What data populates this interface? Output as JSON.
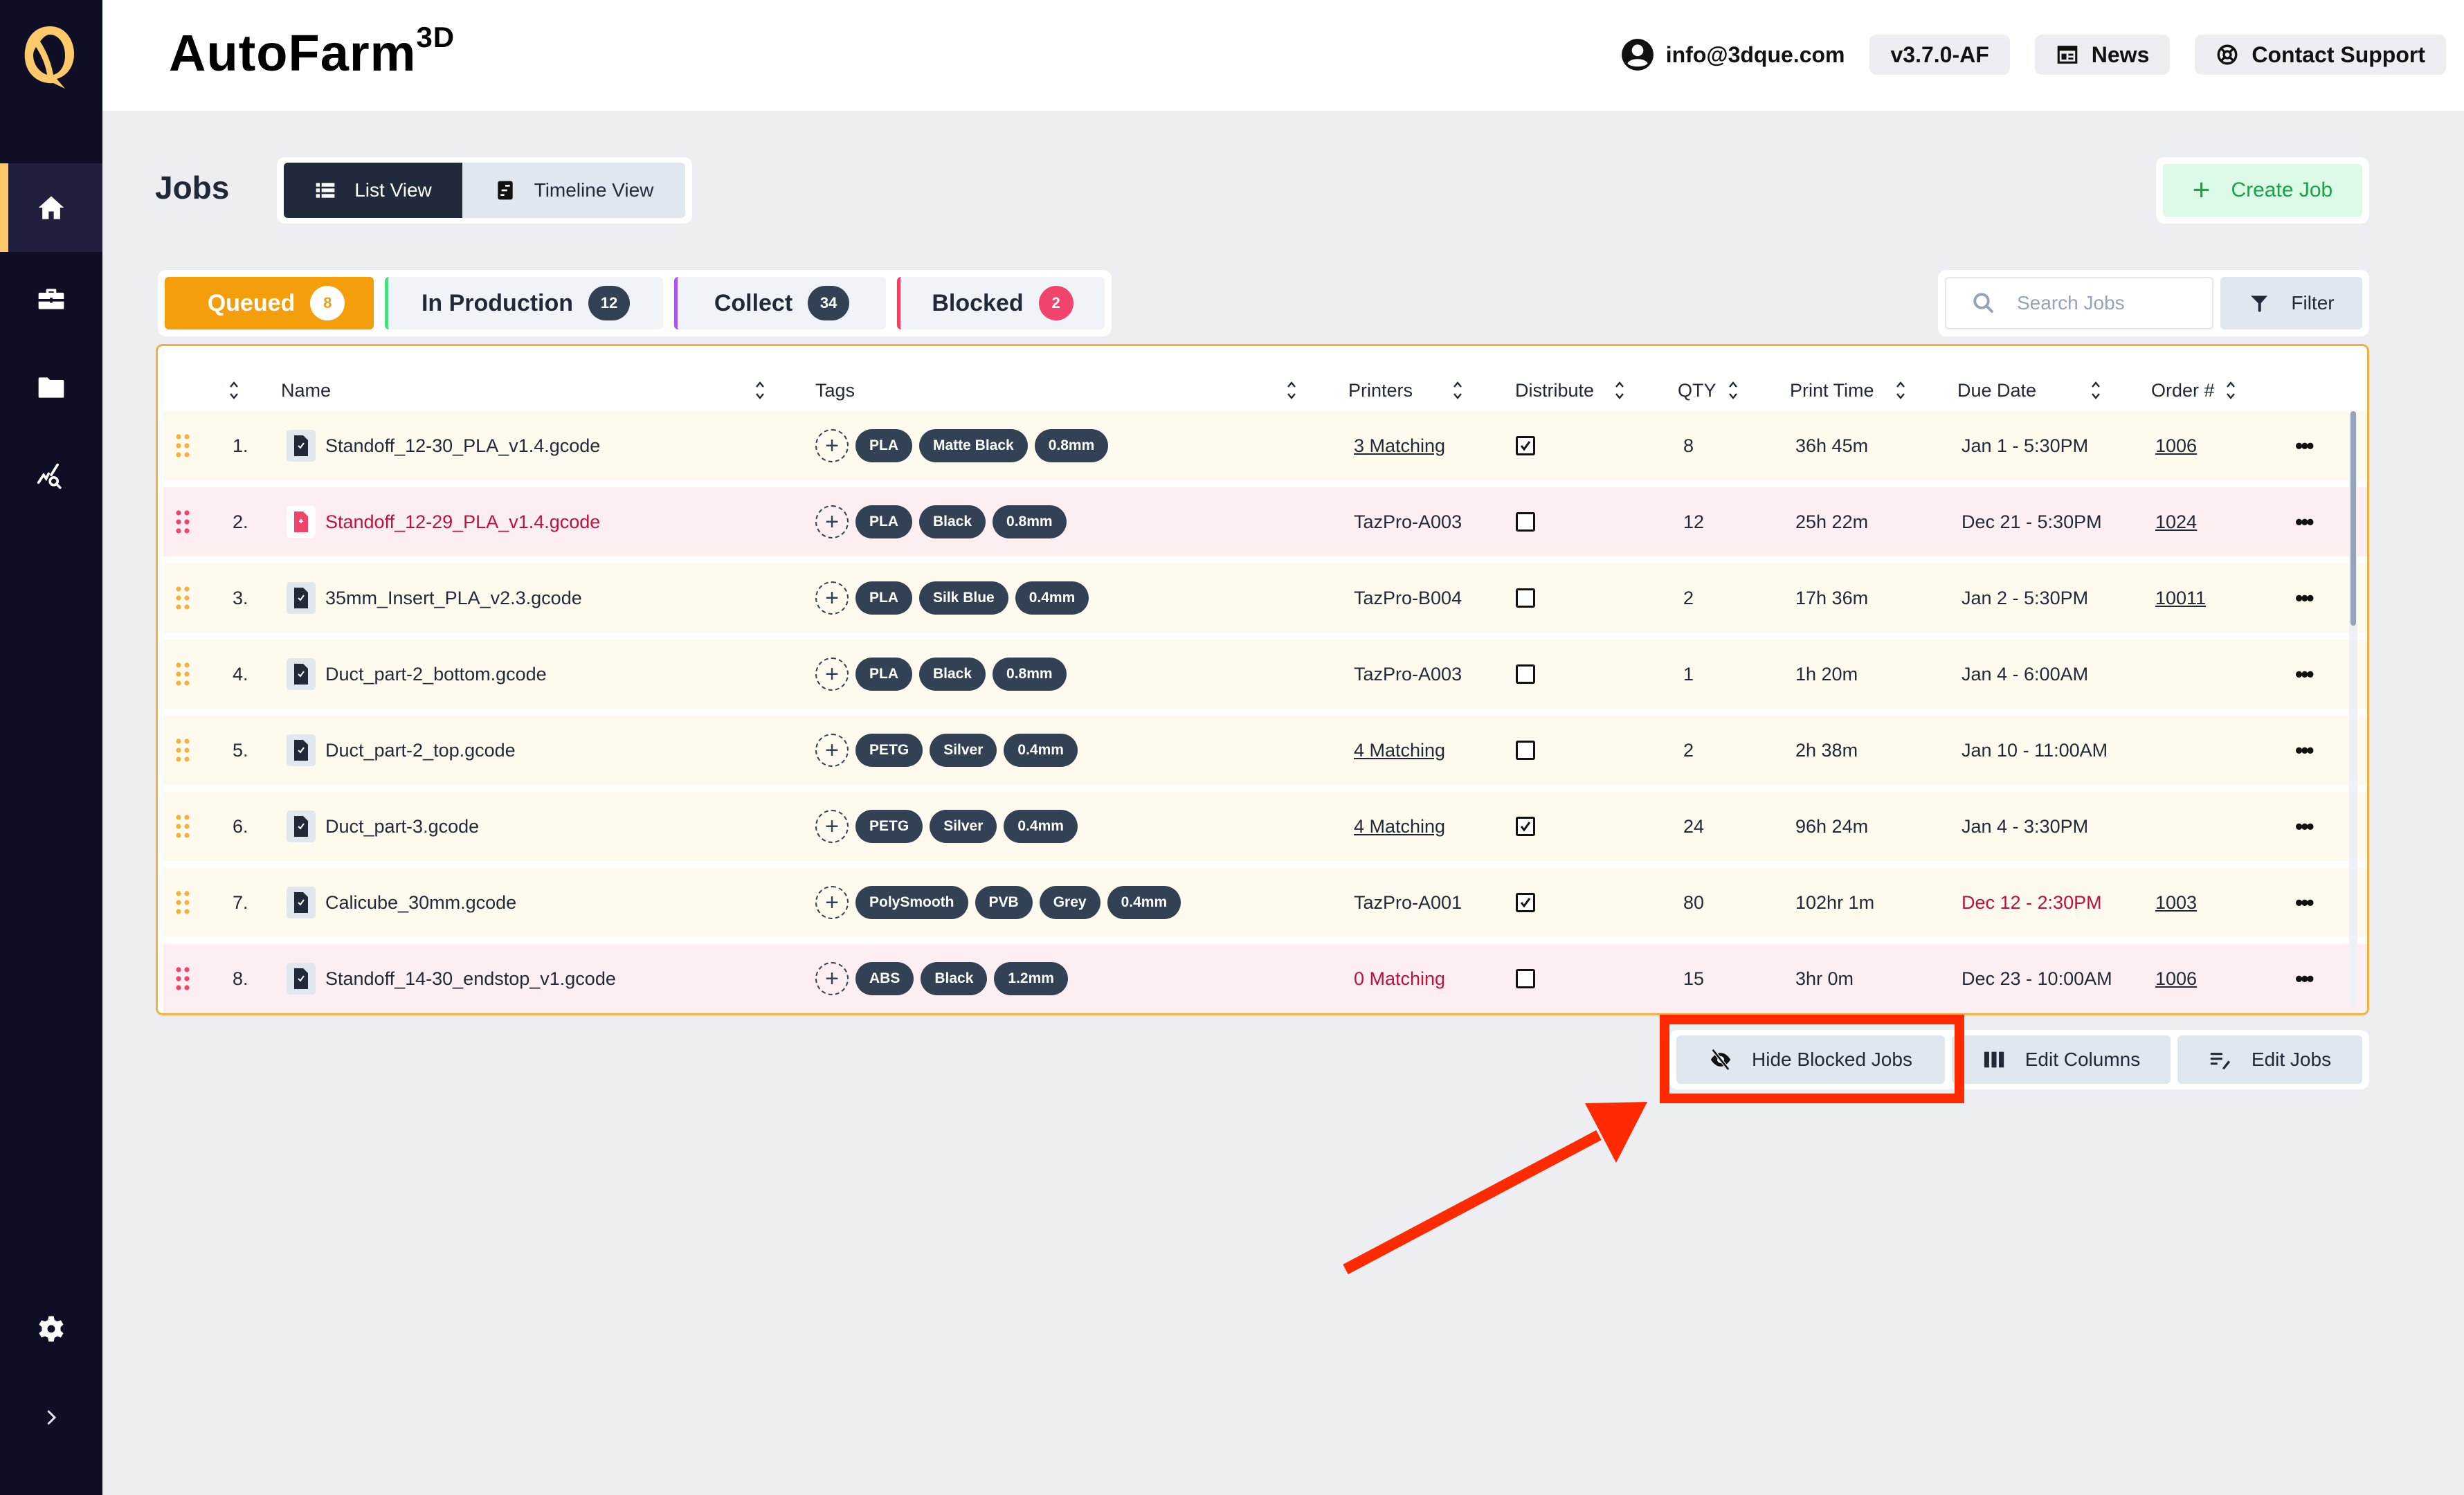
{
  "app": {
    "title": "AutoFarm",
    "title_sup": "3D",
    "user_email": "info@3dque.com",
    "version": "v3.7.0-AF",
    "news_label": "News",
    "support_label": "Contact Support"
  },
  "sidebar": {
    "items": [
      {
        "icon": "home-icon",
        "active": true
      },
      {
        "icon": "briefcase-icon",
        "active": false
      },
      {
        "icon": "folder-icon",
        "active": false
      },
      {
        "icon": "analytics-icon",
        "active": false
      }
    ],
    "bottom": [
      {
        "icon": "gear-icon"
      },
      {
        "icon": "chevron-right-icon"
      }
    ]
  },
  "page": {
    "title": "Jobs",
    "views": [
      {
        "label": "List View",
        "active": true
      },
      {
        "label": "Timeline View",
        "active": false
      }
    ],
    "create_label": "Create Job"
  },
  "tabs": [
    {
      "label": "Queued",
      "count": "8",
      "active": true
    },
    {
      "label": "In Production",
      "count": "12"
    },
    {
      "label": "Collect",
      "count": "34"
    },
    {
      "label": "Blocked",
      "count": "2"
    }
  ],
  "search": {
    "placeholder": "Search Jobs",
    "value": ""
  },
  "filter_label": "Filter",
  "table": {
    "columns": [
      "Name",
      "Tags",
      "Printers",
      "Distribute",
      "QTY",
      "Print Time",
      "Due Date",
      "Order #"
    ],
    "rows": [
      {
        "num": "1.",
        "name": "Standoff_12-30_PLA_v1.4.gcode",
        "tags": [
          "PLA",
          "Matte Black",
          "0.8mm"
        ],
        "printers": "3 Matching",
        "printers_link": true,
        "printers_warn": false,
        "distribute": true,
        "qty": "8",
        "print_time": "36h 45m",
        "due": "Jan 1 - 5:30PM",
        "due_overdue": false,
        "order": "1006",
        "blocked": false,
        "file_error": false
      },
      {
        "num": "2.",
        "name": "Standoff_12-29_PLA_v1.4.gcode",
        "tags": [
          "PLA",
          "Black",
          "0.8mm"
        ],
        "printers": "TazPro-A003",
        "printers_link": false,
        "printers_warn": false,
        "distribute": false,
        "qty": "12",
        "print_time": "25h 22m",
        "due": "Dec 21 - 5:30PM",
        "due_overdue": false,
        "order": "1024",
        "blocked": true,
        "file_error": true
      },
      {
        "num": "3.",
        "name": "35mm_Insert_PLA_v2.3.gcode",
        "tags": [
          "PLA",
          "Silk Blue",
          "0.4mm"
        ],
        "printers": "TazPro-B004",
        "printers_link": false,
        "printers_warn": false,
        "distribute": false,
        "qty": "2",
        "print_time": "17h 36m",
        "due": "Jan 2 - 5:30PM",
        "due_overdue": false,
        "order": "10011",
        "blocked": false,
        "file_error": false
      },
      {
        "num": "4.",
        "name": "Duct_part-2_bottom.gcode",
        "tags": [
          "PLA",
          "Black",
          "0.8mm"
        ],
        "printers": "TazPro-A003",
        "printers_link": false,
        "printers_warn": false,
        "distribute": false,
        "qty": "1",
        "print_time": "1h 20m",
        "due": "Jan 4 - 6:00AM",
        "due_overdue": false,
        "order": "",
        "blocked": false,
        "file_error": false
      },
      {
        "num": "5.",
        "name": "Duct_part-2_top.gcode",
        "tags": [
          "PETG",
          "Silver",
          "0.4mm"
        ],
        "printers": "4 Matching",
        "printers_link": true,
        "printers_warn": false,
        "distribute": false,
        "qty": "2",
        "print_time": "2h 38m",
        "due": "Jan 10 - 11:00AM",
        "due_overdue": false,
        "order": "",
        "blocked": false,
        "file_error": false
      },
      {
        "num": "6.",
        "name": "Duct_part-3.gcode",
        "tags": [
          "PETG",
          "Silver",
          "0.4mm"
        ],
        "printers": "4 Matching",
        "printers_link": true,
        "printers_warn": false,
        "distribute": true,
        "qty": "24",
        "print_time": "96h 24m",
        "due": "Jan 4 - 3:30PM",
        "due_overdue": false,
        "order": "",
        "blocked": false,
        "file_error": false
      },
      {
        "num": "7.",
        "name": "Calicube_30mm.gcode",
        "tags": [
          "PolySmooth",
          "PVB",
          "Grey",
          "0.4mm"
        ],
        "printers": "TazPro-A001",
        "printers_link": false,
        "printers_warn": false,
        "distribute": true,
        "qty": "80",
        "print_time": "102hr 1m",
        "due": "Dec 12 - 2:30PM",
        "due_overdue": true,
        "order": "1003",
        "blocked": false,
        "file_error": false
      },
      {
        "num": "8.",
        "name": "Standoff_14-30_endstop_v1.gcode",
        "tags": [
          "ABS",
          "Black",
          "1.2mm"
        ],
        "printers": "0 Matching",
        "printers_link": false,
        "printers_warn": true,
        "distribute": false,
        "qty": "15",
        "print_time": "3hr 0m",
        "due": "Dec 23 - 10:00AM",
        "due_overdue": false,
        "order": "1006",
        "blocked": true,
        "file_error": false
      }
    ]
  },
  "actions": {
    "hide_blocked": "Hide Blocked Jobs",
    "edit_columns": "Edit Columns",
    "edit_jobs": "Edit Jobs"
  },
  "colors": {
    "accent": "#f59e0b",
    "sidebar_bg": "#0e0f24",
    "in_production": "#4ade80",
    "collect": "#a855f7",
    "blocked": "#f43f5e",
    "annotation": "#ff2a00"
  }
}
